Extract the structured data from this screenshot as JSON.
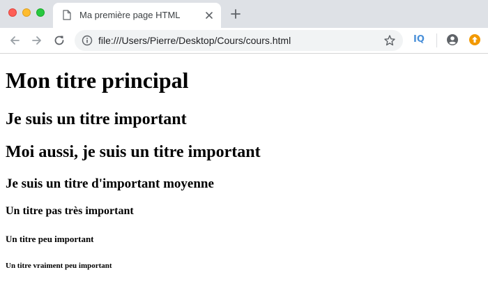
{
  "window": {
    "controls": [
      "close",
      "minimize",
      "maximize"
    ]
  },
  "tab": {
    "title": "Ma première page HTML",
    "icon": "document-icon"
  },
  "toolbar": {
    "url": "file:///Users/Pierre/Desktop/Cours/cours.html",
    "extension_label": "IQ"
  },
  "page": {
    "h1": "Mon titre principal",
    "h2_first": "Je suis un titre important",
    "h2_second": "Moi aussi, je suis un titre important",
    "h3": "Je suis un titre d'important moyenne",
    "h4": "Un titre pas très important",
    "h5": "Un titre peu important",
    "h6": "Un titre vraiment peu important"
  },
  "colors": {
    "tabstrip_bg": "#dee1e6",
    "omnibox_bg": "#f1f3f4",
    "close_light": "#fe5f57",
    "minimize_light": "#febc2e",
    "maximize_light": "#28c840",
    "extension_blue": "#4a90d9",
    "update_badge": "#f29900"
  }
}
